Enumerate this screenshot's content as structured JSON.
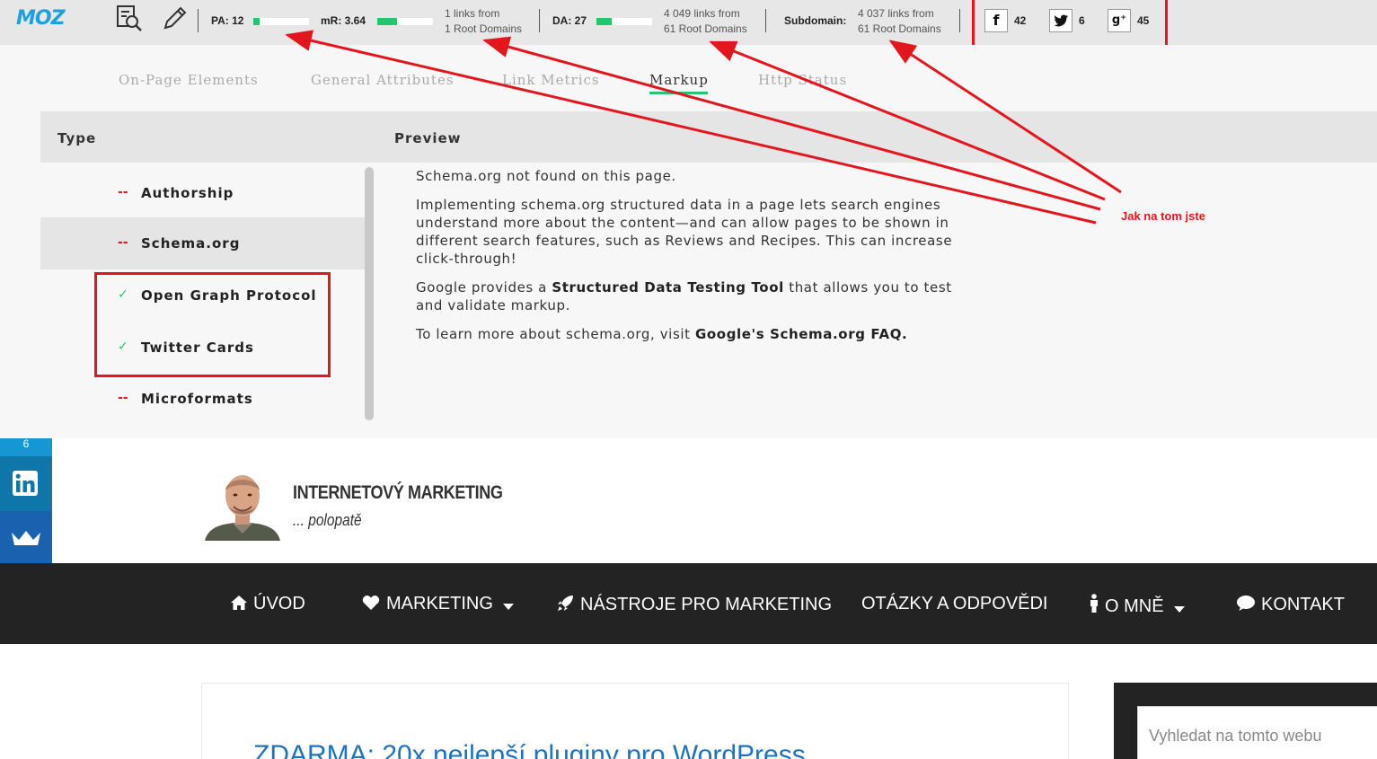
{
  "moz_bar": {
    "logo": "MOZ",
    "pa_label": "PA: 12",
    "pa_fill": 0.12,
    "mr_label": "mR: 3.64",
    "mr_fill": 0.36,
    "page_links": [
      "1 links from",
      "1 Root Domains"
    ],
    "da_label": "DA: 27",
    "da_fill": 0.27,
    "domain_links": [
      "4 049 links from",
      "61 Root Domains"
    ],
    "subdomain_label": "Subdomain:",
    "subdomain_links": [
      "4 037 links from",
      "61 Root Domains"
    ],
    "facebook_count": "42",
    "twitter_count": "6",
    "gplus_count": "45"
  },
  "tabs": [
    {
      "label": "On-Page Elements",
      "active": false
    },
    {
      "label": "General Attributes",
      "active": false
    },
    {
      "label": "Link Metrics",
      "active": false
    },
    {
      "label": "Markup",
      "active": true
    },
    {
      "label": "Http Status",
      "active": false
    }
  ],
  "table": {
    "col_type": "Type",
    "col_preview": "Preview",
    "rows": [
      {
        "mark": "--",
        "label": "Authorship",
        "found": false
      },
      {
        "mark": "--",
        "label": "Schema.org",
        "found": false
      },
      {
        "mark": "✓",
        "label": "Open Graph Protocol",
        "found": true
      },
      {
        "mark": "✓",
        "label": "Twitter Cards",
        "found": true
      },
      {
        "mark": "--",
        "label": "Microformats",
        "found": false
      }
    ]
  },
  "preview": {
    "p1": "Schema.org not found on this page.",
    "p2": "Implementing schema.org structured data in a page lets search engines understand more about the content—and can allow pages to be shown in different search features, such as Reviews and Recipes. This can increase click-through!",
    "p3_pre": "Google provides a ",
    "p3_link": "Structured Data Testing Tool",
    "p3_post": " that allows you to test and validate markup.",
    "p4_pre": "To learn more about schema.org, visit ",
    "p4_link": "Google's Schema.org FAQ."
  },
  "annotation": "Jak na tom jste",
  "share": {
    "count": "6"
  },
  "site": {
    "title": "INTERNETOVÝ MARKETING",
    "subtitle": "... polopatě"
  },
  "nav": [
    {
      "label": "ÚVOD",
      "icon": "home-icon",
      "dropdown": false
    },
    {
      "label": "MARKETING",
      "icon": "heart-icon",
      "dropdown": true
    },
    {
      "label": "NÁSTROJE PRO MARKETING",
      "icon": "rocket-icon",
      "dropdown": false
    },
    {
      "label": "OTÁZKY A ODPOVĚDI",
      "icon": "",
      "dropdown": false
    },
    {
      "label": "O MNĚ",
      "icon": "person-icon",
      "dropdown": true
    },
    {
      "label": "KONTAKT",
      "icon": "comment-icon",
      "dropdown": false
    }
  ],
  "post": {
    "title": "ZDARMA: 20x nejlepší pluginy pro WordPress"
  },
  "search": {
    "placeholder": "Vyhledat na tomto webu"
  },
  "colors": {
    "accent_green": "#22c66e",
    "annotation_red": "#e3161e",
    "moz_blue": "#1ea0db",
    "link_blue": "#1e73be"
  }
}
